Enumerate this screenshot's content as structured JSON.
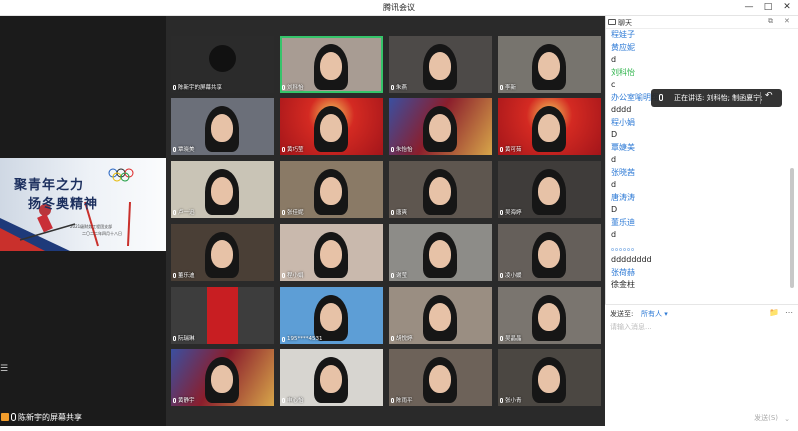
{
  "window": {
    "title": "腾讯会议"
  },
  "share": {
    "slide_line1": "聚青年之力",
    "slide_line2": "扬冬奥精神",
    "slide_sub1": "2021级财务工程团支部",
    "slide_sub2": "二〇二二年四月十八日",
    "sharer_label": "陈新宇的屏幕共享"
  },
  "tiles": [
    {
      "name": "陈新宇的屏幕共享",
      "bg": "#2b2b2b",
      "kind": "avatar"
    },
    {
      "name": "刘科怡",
      "bg": "#a89c93",
      "kind": "person",
      "active": true
    },
    {
      "name": "朱燕",
      "bg": "#4d4a48",
      "kind": "person"
    },
    {
      "name": "李新",
      "bg": "#77746e",
      "kind": "person"
    },
    {
      "name": "覃晓美",
      "bg": "#6b6f79",
      "kind": "person"
    },
    {
      "name": "黄巧莹",
      "bg": "#c2191c",
      "kind": "festive"
    },
    {
      "name": "朱怡怡",
      "bg": "#7c1a26",
      "kind": "hero"
    },
    {
      "name": "黄可茹",
      "bg": "#b51a20",
      "kind": "festive"
    },
    {
      "name": "卢一迅",
      "bg": "#c9c4b6",
      "kind": "person"
    },
    {
      "name": "张佳妮",
      "bg": "#8a7a66",
      "kind": "person"
    },
    {
      "name": "唐爽",
      "bg": "#5e564f",
      "kind": "person"
    },
    {
      "name": "吴海婷",
      "bg": "#3f3c3a",
      "kind": "person"
    },
    {
      "name": "董乐迪",
      "bg": "#4a3f36",
      "kind": "person"
    },
    {
      "name": "程小娟",
      "bg": "#c9b9ad",
      "kind": "person"
    },
    {
      "name": "谢莹",
      "bg": "#8d8c88",
      "kind": "person"
    },
    {
      "name": "凌小媛",
      "bg": "#655f5a",
      "kind": "person"
    },
    {
      "name": "阮瑞琳",
      "bg": "#3d3d3d",
      "kind": "redpanel"
    },
    {
      "name": "195****4531",
      "bg": "#5d9ed6",
      "kind": "person"
    },
    {
      "name": "胡悦婷",
      "bg": "#9a8e82",
      "kind": "person"
    },
    {
      "name": "吴晶晶",
      "bg": "#7a756f",
      "kind": "person"
    },
    {
      "name": "黄静宇",
      "bg": "#2f3b66",
      "kind": "hero"
    },
    {
      "name": "申心怡",
      "bg": "#d7d5d0",
      "kind": "person"
    },
    {
      "name": "陈雨平",
      "bg": "#6d6259",
      "kind": "person"
    },
    {
      "name": "张小青",
      "bg": "#4b4742",
      "kind": "person"
    }
  ],
  "chat": {
    "header": "聊天",
    "messages": [
      {
        "text": "程娃子",
        "type": "name"
      },
      {
        "text": "黄应妮",
        "type": "name"
      },
      {
        "text": "d",
        "type": "text"
      },
      {
        "text": "刘科怡",
        "type": "name",
        "green": true
      },
      {
        "text": "c",
        "type": "text"
      },
      {
        "text": "办公室喻明翔",
        "type": "name"
      },
      {
        "text": "dddd",
        "type": "text"
      },
      {
        "text": "程小娟",
        "type": "name"
      },
      {
        "text": "D",
        "type": "text"
      },
      {
        "text": "覃婕美",
        "type": "name"
      },
      {
        "text": "d",
        "type": "text"
      },
      {
        "text": "张晓茜",
        "type": "name"
      },
      {
        "text": "d",
        "type": "text"
      },
      {
        "text": "唐涛涛",
        "type": "name"
      },
      {
        "text": "D",
        "type": "text"
      },
      {
        "text": "董乐迪",
        "type": "name"
      },
      {
        "text": "d",
        "type": "text"
      },
      {
        "text": "。。。。。。",
        "type": "name"
      },
      {
        "text": "dddddddd",
        "type": "text"
      },
      {
        "text": "张荷赫",
        "type": "name"
      },
      {
        "text": "徐金柱",
        "type": "text"
      }
    ],
    "speaking": "正在讲话: 刘科怡; 制函夏宁;",
    "send_to_label": "发送至:",
    "send_to_value": "所有人",
    "placeholder": "请输入消息...",
    "send_button": "发送(S)"
  }
}
